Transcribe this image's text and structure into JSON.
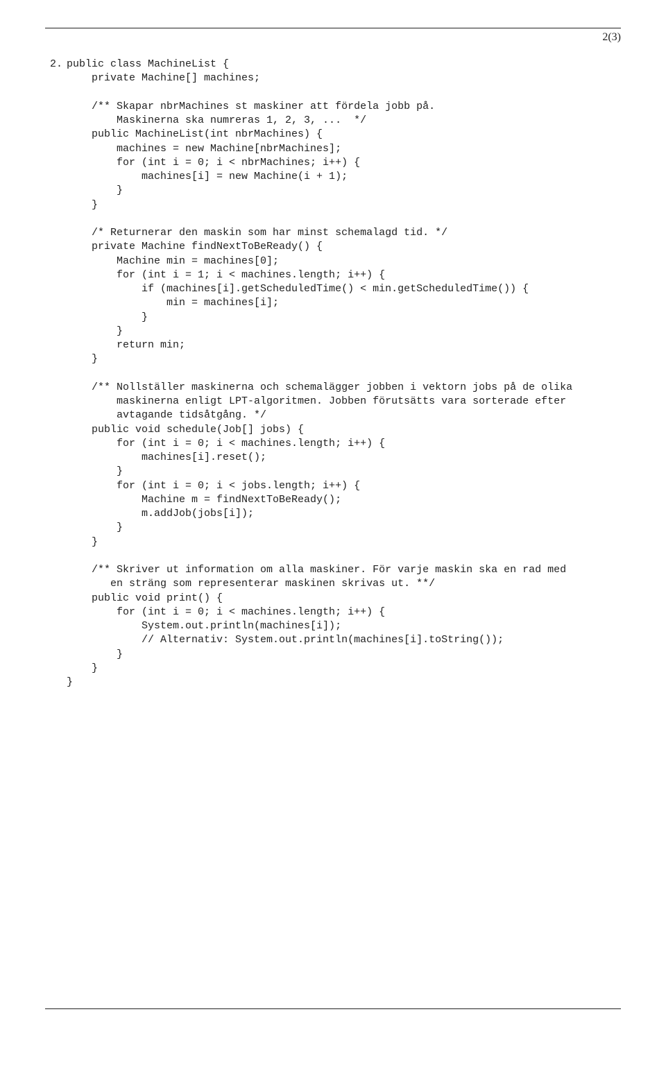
{
  "page_number": "2(3)",
  "item_number": "2.",
  "code": "public class MachineList {\n    private Machine[] machines;\n\n    /** Skapar nbrMachines st maskiner att fördela jobb på.\n        Maskinerna ska numreras 1, 2, 3, ...  */\n    public MachineList(int nbrMachines) {\n        machines = new Machine[nbrMachines];\n        for (int i = 0; i < nbrMachines; i++) {\n            machines[i] = new Machine(i + 1);\n        }\n    }\n\n    /* Returnerar den maskin som har minst schemalagd tid. */\n    private Machine findNextToBeReady() {\n        Machine min = machines[0];\n        for (int i = 1; i < machines.length; i++) {\n            if (machines[i].getScheduledTime() < min.getScheduledTime()) {\n                min = machines[i];\n            }\n        }\n        return min;\n    }\n\n    /** Nollställer maskinerna och schemalägger jobben i vektorn jobs på de olika\n        maskinerna enligt LPT-algoritmen. Jobben förutsätts vara sorterade efter\n        avtagande tidsåtgång. */\n    public void schedule(Job[] jobs) {\n        for (int i = 0; i < machines.length; i++) {\n            machines[i].reset();\n        }\n        for (int i = 0; i < jobs.length; i++) {\n            Machine m = findNextToBeReady();\n            m.addJob(jobs[i]);\n        }\n    }\n\n    /** Skriver ut information om alla maskiner. För varje maskin ska en rad med\n       en sträng som representerar maskinen skrivas ut. **/\n    public void print() {\n        for (int i = 0; i < machines.length; i++) {\n            System.out.println(machines[i]);\n            // Alternativ: System.out.println(machines[i].toString());\n        }\n    }\n}"
}
